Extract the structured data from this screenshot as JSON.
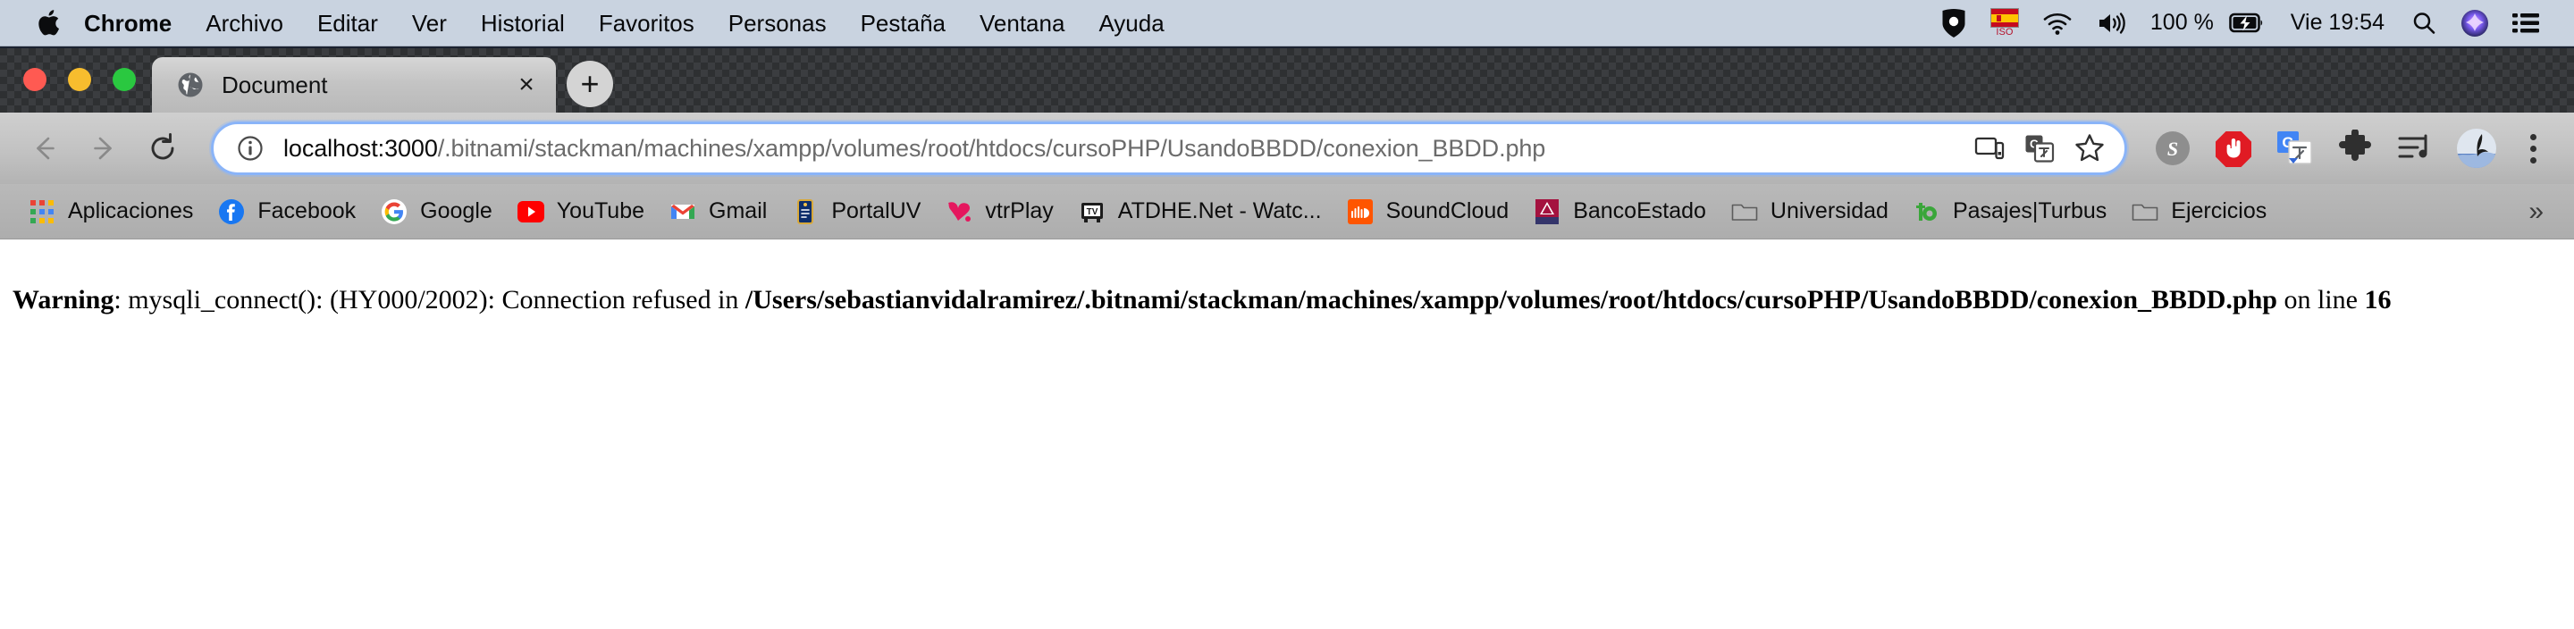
{
  "menubar": {
    "apple_icon": "apple-logo",
    "items": [
      {
        "label": "Chrome",
        "bold": true
      },
      {
        "label": "Archivo",
        "bold": false
      },
      {
        "label": "Editar",
        "bold": false
      },
      {
        "label": "Ver",
        "bold": false
      },
      {
        "label": "Historial",
        "bold": false
      },
      {
        "label": "Favoritos",
        "bold": false
      },
      {
        "label": "Personas",
        "bold": false
      },
      {
        "label": "Pestaña",
        "bold": false
      },
      {
        "label": "Ventana",
        "bold": false
      },
      {
        "label": "Ayuda",
        "bold": false
      }
    ],
    "status": {
      "bitwarden_icon": "bitwarden-icon",
      "input_source_flag": "spain-flag-iso-icon",
      "input_source_label": "ISO",
      "wifi_icon": "wifi-icon",
      "volume_icon": "volume-icon",
      "battery_percent": "100 %",
      "battery_icon": "battery-charging-icon",
      "clock": "Vie 19:54",
      "search_icon": "spotlight-search-icon",
      "siri_icon": "siri-icon",
      "control_center_icon": "control-center-icon"
    }
  },
  "window_controls": {
    "close": "close-window-button",
    "minimize": "minimize-window-button",
    "maximize": "maximize-window-button"
  },
  "tabstrip": {
    "tab": {
      "favicon": "globe-icon",
      "title": "Document",
      "close_label": "×"
    },
    "new_tab_label": "+"
  },
  "toolbar": {
    "back_icon": "back-arrow-icon",
    "forward_icon": "forward-arrow-icon",
    "reload_icon": "reload-icon",
    "security_icon": "info-circle-icon",
    "url": {
      "host": "localhost:3000",
      "path": "/.bitnami/stackman/machines/xampp/volumes/root/htdocs/cursoPHP/UsandoBBDD/conexion_BBDD.php",
      "full": "localhost:3000/.bitnami/stackman/machines/xampp/volumes/root/htdocs/cursoPHP/UsandoBBDD/conexion_BBDD.php"
    },
    "actions": [
      {
        "name": "cast-icon"
      },
      {
        "name": "translate-icon"
      },
      {
        "name": "bookmark-star-icon"
      }
    ],
    "extensions": [
      {
        "name": "skype-extension-icon",
        "label": "S"
      },
      {
        "name": "adblock-extension-icon",
        "label": ""
      },
      {
        "name": "google-translate-extension-icon",
        "label": "G"
      },
      {
        "name": "extensions-puzzle-icon",
        "label": ""
      },
      {
        "name": "music-playlist-extension-icon",
        "label": ""
      }
    ],
    "profile_icon": "profile-avatar-icon",
    "menu_icon": "chrome-menu-icon"
  },
  "bookmarks": {
    "items": [
      {
        "label": "Aplicaciones",
        "icon": "apps-grid-icon"
      },
      {
        "label": "Facebook",
        "icon": "facebook-icon"
      },
      {
        "label": "Google",
        "icon": "google-icon"
      },
      {
        "label": "YouTube",
        "icon": "youtube-icon"
      },
      {
        "label": "Gmail",
        "icon": "gmail-icon"
      },
      {
        "label": "PortalUV",
        "icon": "portaluv-icon"
      },
      {
        "label": "vtrPlay",
        "icon": "vtrplay-icon"
      },
      {
        "label": "ATDHE.Net - Watc...",
        "icon": "atdhe-tv-icon"
      },
      {
        "label": "SoundCloud",
        "icon": "soundcloud-icon"
      },
      {
        "label": "BancoEstado",
        "icon": "bancoestado-icon"
      },
      {
        "label": "Universidad",
        "icon": "folder-icon"
      },
      {
        "label": "Pasajes|Turbus",
        "icon": "turbus-icon"
      },
      {
        "label": "Ejercicios",
        "icon": "folder-icon"
      }
    ],
    "overflow_label": "»"
  },
  "page": {
    "warning": {
      "label": "Warning",
      "colon": ": ",
      "message": "mysqli_connect(): (HY000/2002): Connection refused in ",
      "file_path": "/Users/sebastianvidalramirez/.bitnami/stackman/machines/xampp/volumes/root/htdocs/cursoPHP/UsandoBBDD/conexion_BBDD.php",
      "on_line_text": " on line ",
      "line_number": "16"
    }
  },
  "colors": {
    "menubar_bg": "#c9d3e0",
    "tabstrip_bg": "#34363a",
    "toolbar_bg": "#c2c2c2",
    "bookmarks_bg": "#b3b3b3",
    "omnibox_focus": "#8ab4f8",
    "page_bg": "#ffffff"
  }
}
